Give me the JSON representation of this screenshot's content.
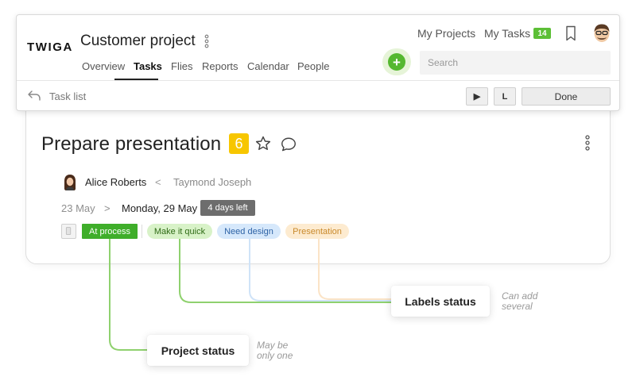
{
  "app": {
    "logo": "TWIGA",
    "project_title": "Customer project"
  },
  "nav": {
    "tabs": [
      {
        "label": "Overview",
        "active": false
      },
      {
        "label": "Tasks",
        "active": true
      },
      {
        "label": "Flies",
        "active": false
      },
      {
        "label": "Reports",
        "active": false
      },
      {
        "label": "Calendar",
        "active": false
      },
      {
        "label": "People",
        "active": false
      }
    ]
  },
  "top": {
    "my_projects": "My Projects",
    "my_tasks": "My Tasks",
    "tasks_count": "14",
    "add_label": "+",
    "search_placeholder": "Search"
  },
  "subbar": {
    "back_label": "Task list",
    "play_label": "▶",
    "l_label": "L",
    "done_label": "Done"
  },
  "task": {
    "title": "Prepare presentation",
    "priority": "6",
    "assignee": "Alice Roberts",
    "separator": "<",
    "reporter": "Taymond Joseph",
    "start_date": "23 May",
    "date_arrow": ">",
    "due_date": "Monday, 29 May",
    "days_left": "4 days left",
    "project_status": "At process",
    "labels": [
      "Make it quick",
      "Need design",
      "Presentation"
    ]
  },
  "annotations": {
    "labels_status": "Labels status",
    "labels_note": [
      "Can add",
      "several"
    ],
    "project_status": "Project status",
    "project_note": [
      "May be",
      "only one"
    ]
  },
  "colors": {
    "accent_green": "#55b830",
    "status_green": "#3fae2a",
    "priority_yellow": "#f7c600",
    "label_green_bg": "#d8f2c8",
    "label_blue_bg": "#d6e8fb",
    "label_orange_bg": "#fdebd0"
  }
}
